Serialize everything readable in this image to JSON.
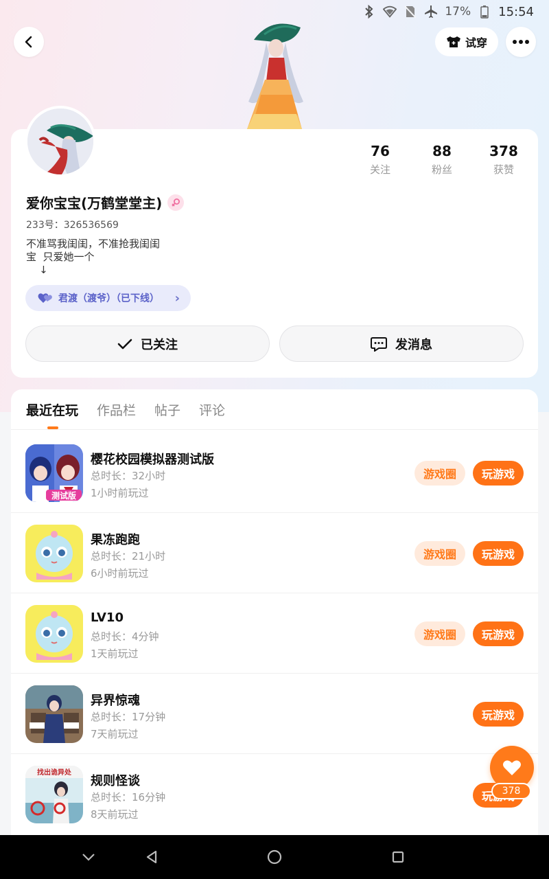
{
  "status_bar": {
    "battery": "17%",
    "time": "15:54",
    "icons": [
      "bluetooth-icon",
      "wifi-icon",
      "no-sim-icon",
      "airplane-icon",
      "battery-icon"
    ]
  },
  "header": {
    "back_icon": "chevron-left-icon",
    "try_on_label": "试穿",
    "more_icon": "more-dots-icon"
  },
  "profile": {
    "stats": [
      {
        "value": "76",
        "label": "关注"
      },
      {
        "value": "88",
        "label": "粉丝"
      },
      {
        "value": "378",
        "label": "获赞"
      }
    ],
    "name": "爱你宝宝(万鹤堂堂主)",
    "gender": "female",
    "uid": "233号：326536569",
    "bio": "不准骂我闺闺，不准抢我闺闺\n宝  只爱她一个\n    ↓",
    "cp_chip": "君渡（渡爷）（已下线）",
    "follow_button": "已关注",
    "message_button": "发消息"
  },
  "tabs": [
    {
      "label": "最近在玩",
      "active": true
    },
    {
      "label": "作品栏",
      "active": false
    },
    {
      "label": "帖子",
      "active": false
    },
    {
      "label": "评论",
      "active": false
    }
  ],
  "games": [
    {
      "title": "樱花校园模拟器测试版",
      "duration": "总时长：32小时",
      "last_played": "1小时前玩过",
      "circle_label": "游戏圈",
      "play_label": "玩游戏",
      "has_circle": true
    },
    {
      "title": "果冻跑跑",
      "duration": "总时长：21小时",
      "last_played": "6小时前玩过",
      "circle_label": "游戏圈",
      "play_label": "玩游戏",
      "has_circle": true
    },
    {
      "title": "LV10",
      "duration": "总时长：4分钟",
      "last_played": "1天前玩过",
      "circle_label": "游戏圈",
      "play_label": "玩游戏",
      "has_circle": true
    },
    {
      "title": "异界惊魂",
      "duration": "总时长：17分钟",
      "last_played": "7天前玩过",
      "play_label": "玩游戏",
      "has_circle": false
    },
    {
      "title": "规则怪谈",
      "duration": "总时长：16分钟",
      "last_played": "8天前玩过",
      "play_label": "玩游戏",
      "has_circle": false
    }
  ],
  "game_icon_texts": {
    "sakura_badge": "测试版",
    "rules_banner": "找出诡异处"
  },
  "fab": {
    "icon": "heart-icon",
    "count": "378"
  },
  "colors": {
    "accent": "#ff7216",
    "accent_light": "#ffeadc",
    "chip_bg": "#e9ebfb",
    "chip_text": "#5b62c9"
  }
}
